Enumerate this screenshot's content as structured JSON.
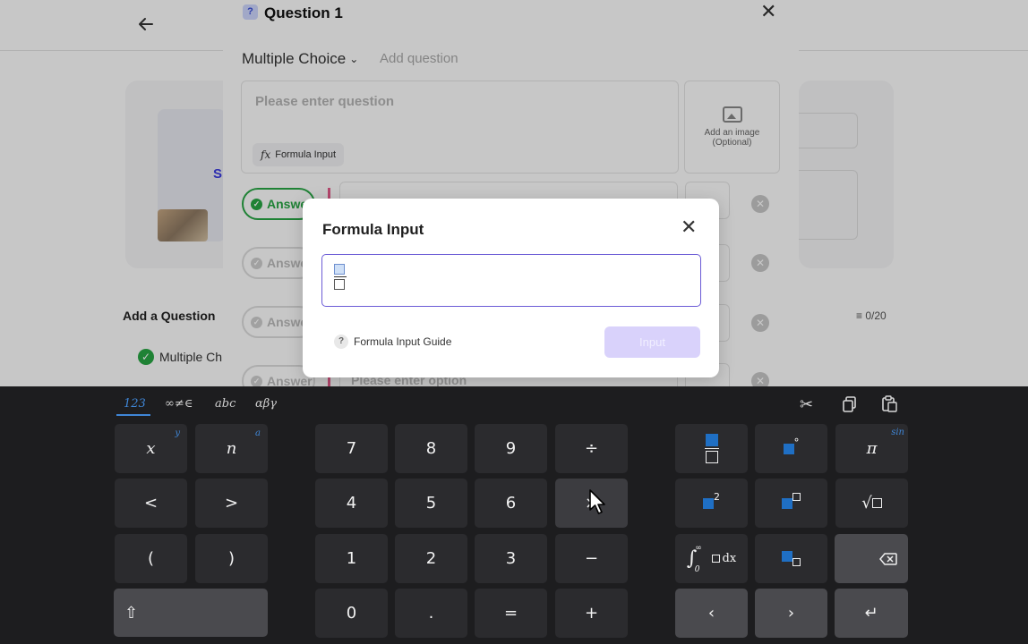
{
  "background": {
    "add_question_label": "Add a Question",
    "multiple_choice_item": "Multiple Ch",
    "counter": "0/20",
    "thumb_letter": "S"
  },
  "question_modal": {
    "title": "Question 1",
    "type_label": "Multiple Choice",
    "add_question_link": "Add question",
    "question_placeholder": "Please enter question",
    "formula_button": "Formula Input",
    "image_upload_line1": "Add an image",
    "image_upload_line2": "(Optional)",
    "answer_label": "Answer",
    "option_placeholder": "Please enter option"
  },
  "formula_dialog": {
    "title": "Formula Input",
    "guide_label": "Formula Input Guide",
    "input_button": "Input"
  },
  "keyboard": {
    "tabs": [
      "123",
      "∞≠∈",
      "abc",
      "αβγ"
    ],
    "active_tab": "123",
    "keys": {
      "x": "x",
      "x_alt": "y",
      "n": "n",
      "n_alt": "a",
      "lt": "<",
      "gt": ">",
      "lparen": "(",
      "rparen": ")",
      "k7": "7",
      "k8": "8",
      "k9": "9",
      "div": "÷",
      "k4": "4",
      "k5": "5",
      "k6": "6",
      "mul": "×",
      "k1": "1",
      "k2": "2",
      "k3": "3",
      "minus": "−",
      "k0": "0",
      "dot": ".",
      "eq": "=",
      "plus": "+",
      "pi": "π",
      "sin": "sin",
      "deg": "°",
      "sq2": "2",
      "dx": "dx",
      "inf": "∞",
      "zero_sub": "0"
    }
  },
  "colors": {
    "accent_blue": "#3f86d6",
    "dialog_border": "#6b5bd6",
    "input_button_bg": "#d9d2fb",
    "answer_green": "#28a745",
    "keyboard_bg": "#1d1d1f",
    "key_bg": "#2b2b2e"
  }
}
